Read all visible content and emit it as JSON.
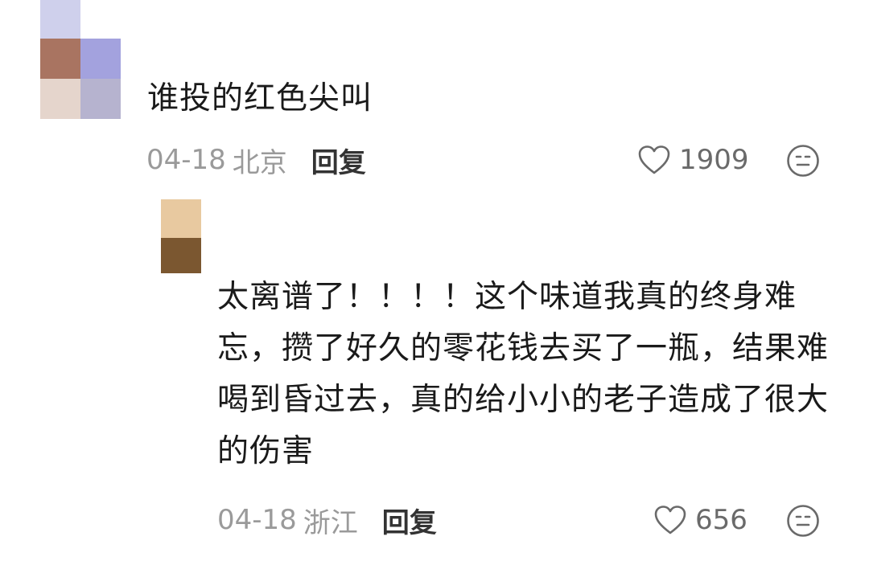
{
  "comments": [
    {
      "text": "谁投的红色尖叫",
      "date": "04-18",
      "location": "北京",
      "reply_label": "回复",
      "like_count": "1909",
      "avatar_colors": [
        "#cfd0ec",
        "#ffffff",
        "#a97461",
        "#a3a2de",
        "#e5d5cc",
        "#b6b3cf"
      ]
    },
    {
      "text": "太离谱了！！！！这个味道我真的终身难忘，攒了好久的零花钱去买了一瓶，结果难喝到昏过去，真的给小小的老子造成了很大的伤害",
      "date": "04-18",
      "location": "浙江",
      "reply_label": "回复",
      "like_count": "656",
      "avatar_colors": [
        "#e8c9a0",
        "#7b5730"
      ]
    }
  ],
  "icons": {
    "like": "heart-outline-icon",
    "emoji": "neutral-face-icon"
  },
  "colors": {
    "text": "#1a1a1a",
    "meta": "#9a9a9a",
    "reply": "#333333",
    "icon": "#6a6a6a"
  }
}
